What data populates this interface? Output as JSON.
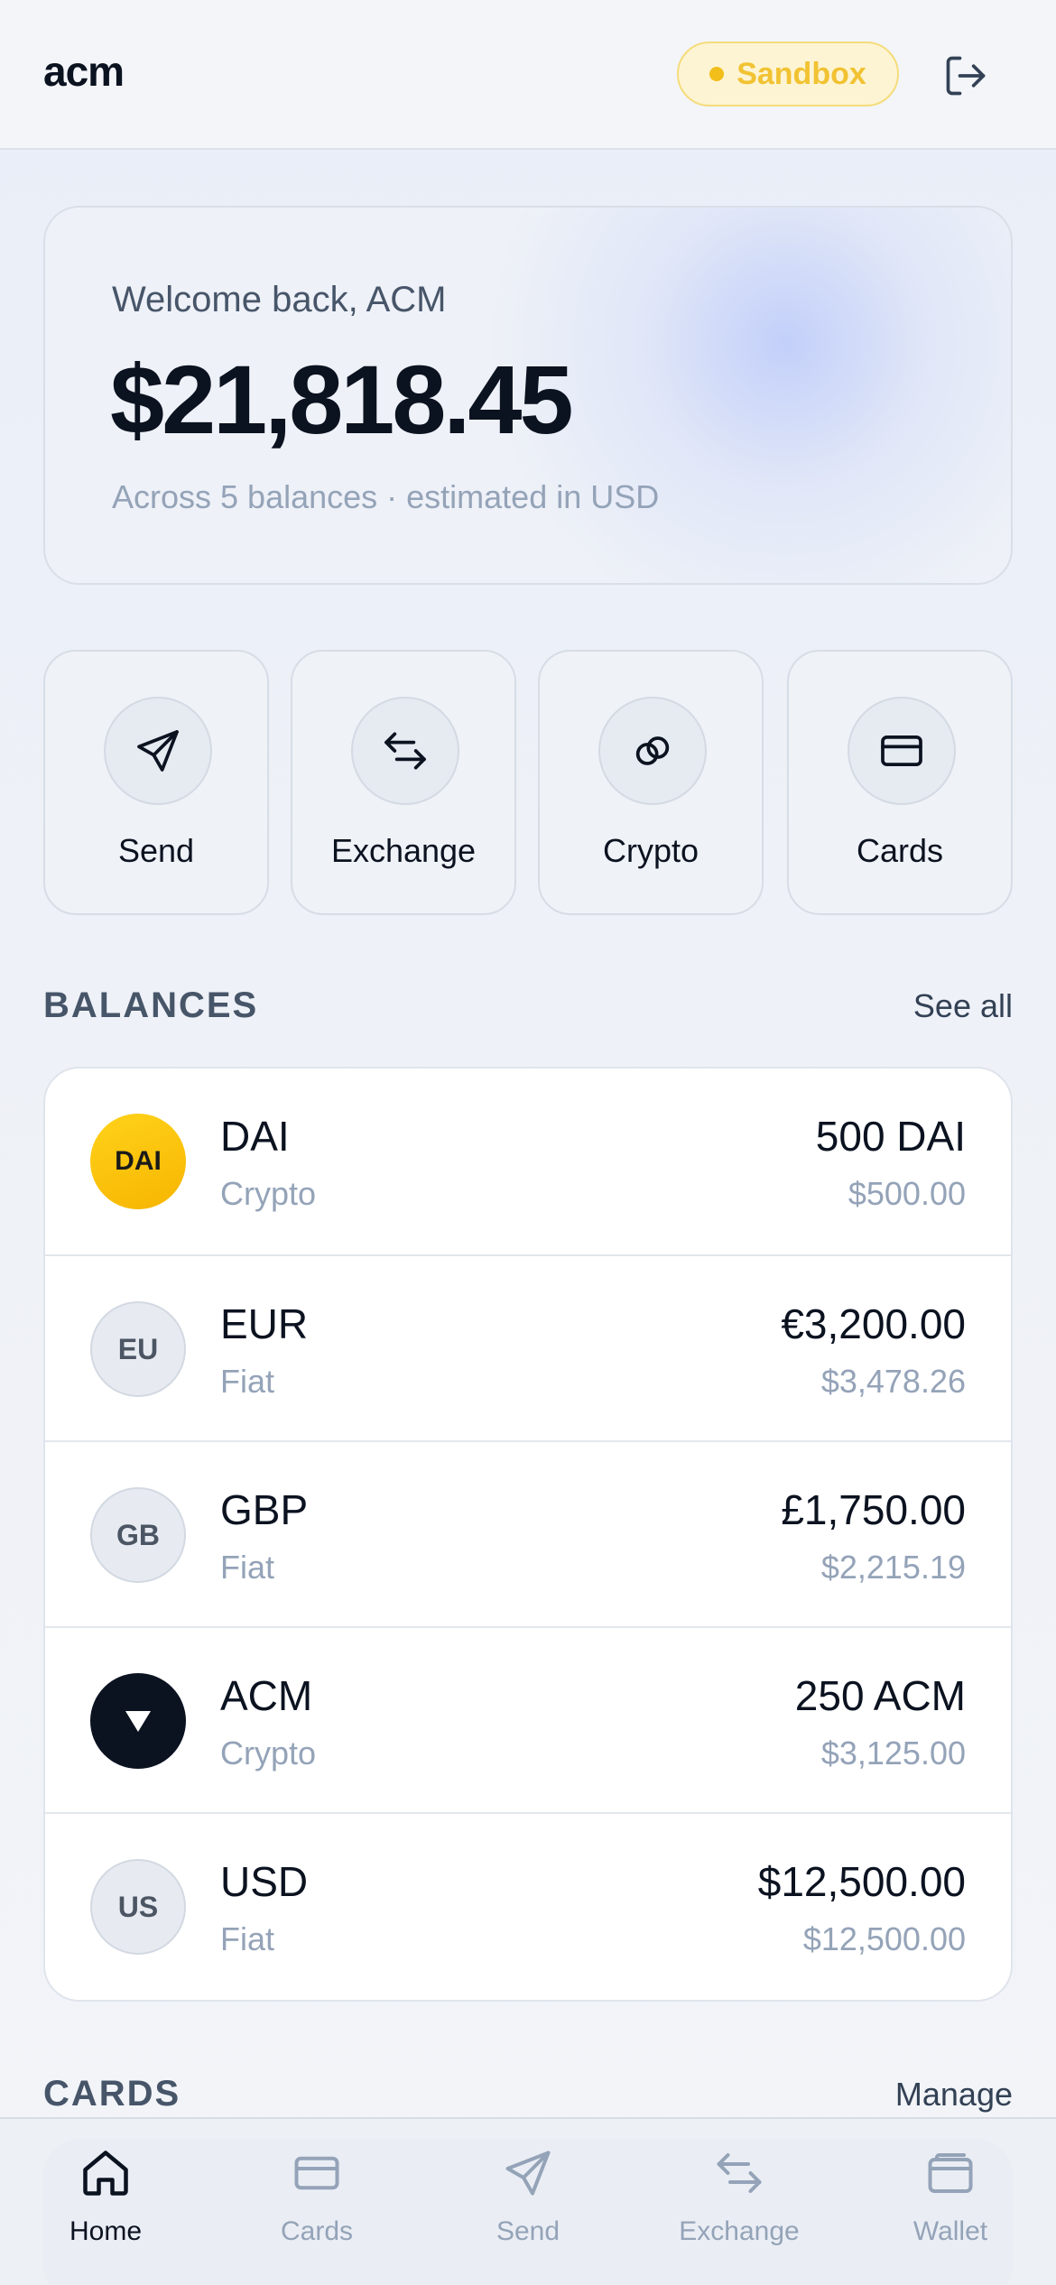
{
  "header": {
    "logo": "acm",
    "badge": "Sandbox"
  },
  "welcome": {
    "greeting": "Welcome back, ACM",
    "total": "$21,818.45",
    "subtitle": "Across 5 balances · estimated in USD"
  },
  "actions": [
    {
      "label": "Send",
      "icon": "send-icon"
    },
    {
      "label": "Exchange",
      "icon": "exchange-icon"
    },
    {
      "label": "Crypto",
      "icon": "link-icon"
    },
    {
      "label": "Cards",
      "icon": "card-icon"
    }
  ],
  "balances_section": {
    "title": "BALANCES",
    "link": "See all"
  },
  "balances": [
    {
      "avatar": "DAI",
      "name": "DAI",
      "kind": "Crypto",
      "amount": "500 DAI",
      "usd": "$500.00"
    },
    {
      "avatar": "EU",
      "name": "EUR",
      "kind": "Fiat",
      "amount": "€3,200.00",
      "usd": "$3,478.26"
    },
    {
      "avatar": "GB",
      "name": "GBP",
      "kind": "Fiat",
      "amount": "£1,750.00",
      "usd": "$2,215.19"
    },
    {
      "avatar": "",
      "name": "ACM",
      "kind": "Crypto",
      "amount": "250 ACM",
      "usd": "$3,125.00"
    },
    {
      "avatar": "US",
      "name": "USD",
      "kind": "Fiat",
      "amount": "$12,500.00",
      "usd": "$12,500.00"
    }
  ],
  "cards_section": {
    "title": "CARDS",
    "link": "Manage"
  },
  "tabbar": [
    {
      "label": "Home",
      "icon": "home-icon",
      "active": true
    },
    {
      "label": "Cards",
      "icon": "card-icon"
    },
    {
      "label": "Send",
      "icon": "send-icon"
    },
    {
      "label": "Exchange",
      "icon": "exchange-icon"
    },
    {
      "label": "Wallet",
      "icon": "wallet-icon"
    }
  ],
  "colors": {
    "accent": "#0b1220",
    "sandbox": "#f1c232",
    "muted": "#94a3b8"
  }
}
